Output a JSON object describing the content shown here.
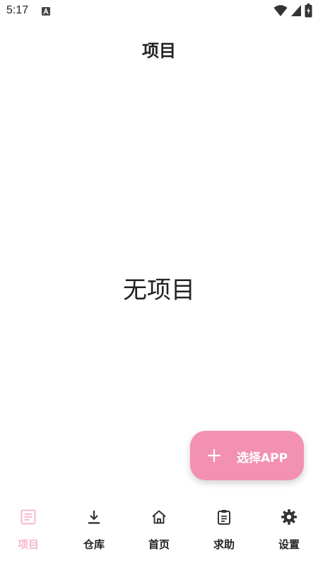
{
  "status_bar": {
    "time": "5:17",
    "icons": [
      "app-notification-icon",
      "wifi-icon",
      "signal-icon",
      "battery-icon"
    ]
  },
  "header": {
    "title": "项目"
  },
  "main": {
    "empty_text": "无项目"
  },
  "fab": {
    "label": "选择APP",
    "icon": "plus-icon",
    "color": "#f291b2"
  },
  "bottom_nav": {
    "active_color": "#f7b8cd",
    "items": [
      {
        "label": "项目",
        "icon": "list-icon",
        "active": true
      },
      {
        "label": "仓库",
        "icon": "download-icon",
        "active": false
      },
      {
        "label": "首页",
        "icon": "home-icon",
        "active": false
      },
      {
        "label": "求助",
        "icon": "clipboard-icon",
        "active": false
      },
      {
        "label": "设置",
        "icon": "gear-icon",
        "active": false
      }
    ]
  }
}
